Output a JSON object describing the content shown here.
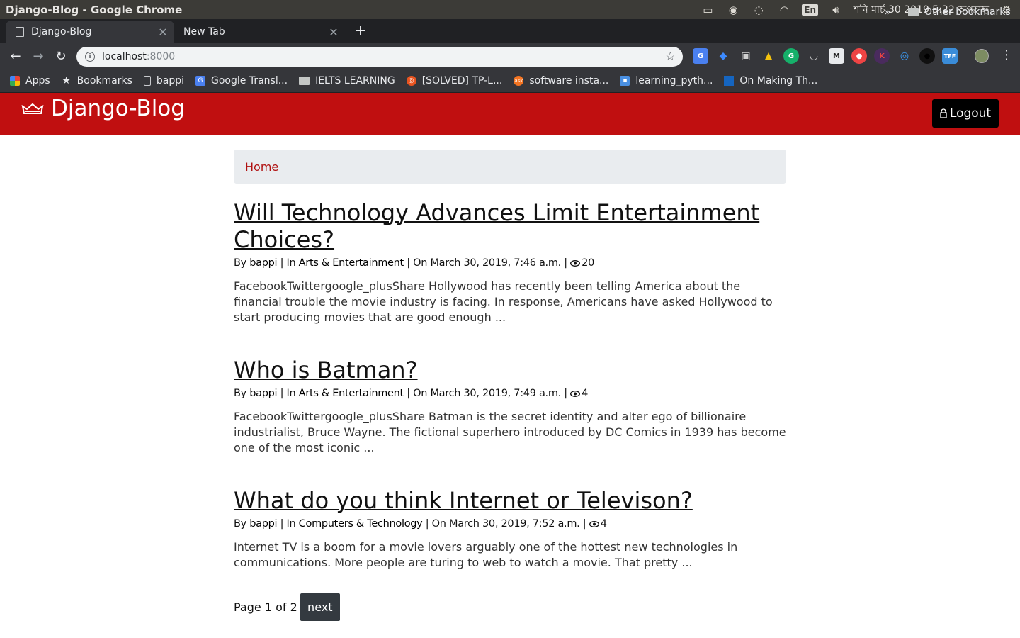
{
  "os": {
    "window_title": "Django-Blog - Google Chrome",
    "lang": "En",
    "clock": "শনি মার্চ 30 2019  5:22 অপরাহ্ন"
  },
  "browser": {
    "tabs": [
      {
        "label": "Django-Blog",
        "active": true
      },
      {
        "label": "New Tab",
        "active": false
      }
    ],
    "url_host": "localhost",
    "url_port": ":8000",
    "bookmarks": [
      {
        "label": "Apps"
      },
      {
        "label": "Bookmarks"
      },
      {
        "label": "bappi"
      },
      {
        "label": "Google Transl..."
      },
      {
        "label": "IELTS LEARNING"
      },
      {
        "label": "[SOLVED] TP-L..."
      },
      {
        "label": "software insta..."
      },
      {
        "label": "learning_pyth..."
      },
      {
        "label": "On Making Th..."
      }
    ],
    "other_bookmarks": "Other bookmarks",
    "more": "»"
  },
  "site": {
    "brand": "Django-Blog",
    "logout": "Logout",
    "brand_color": "#c00f10"
  },
  "breadcrumb": "Home",
  "posts": [
    {
      "title": "Will Technology Advances Limit Entertainment Choices?",
      "by_label": "By ",
      "author": "bappi",
      "in_label": " | In ",
      "category": "Arts & Entertainment",
      "date": " | On March 30, 2019, 7:46 a.m. | ",
      "views": "20",
      "excerpt": "FacebookTwittergoogle_plusShare Hollywood has recently been telling America about the financial trouble the movie industry is facing. In response, Americans have asked Hollywood to start producing movies that are good enough ..."
    },
    {
      "title": "Who is Batman?",
      "by_label": "By ",
      "author": "bappi",
      "in_label": " | In ",
      "category": "Arts & Entertainment",
      "date": " | On March 30, 2019, 7:49 a.m. | ",
      "views": "4",
      "excerpt": "FacebookTwittergoogle_plusShare Batman is the secret identity and alter ego of billionaire industrialist, Bruce Wayne. The fictional superhero introduced by DC Comics in 1939 has become one of the most iconic ..."
    },
    {
      "title": "What do you think Internet or Televison?",
      "by_label": "By ",
      "author": "bappi",
      "in_label": " | In ",
      "category": "Computers & Technology",
      "date": " | On March 30, 2019, 7:52 a.m. | ",
      "views": "4",
      "excerpt": "Internet TV is a boom for a movie lovers arguably one of the hottest new technologies in communications. More people are turing to web to watch a movie. That pretty ..."
    }
  ],
  "pagination": {
    "info": "Page 1 of 2",
    "next": "next"
  }
}
